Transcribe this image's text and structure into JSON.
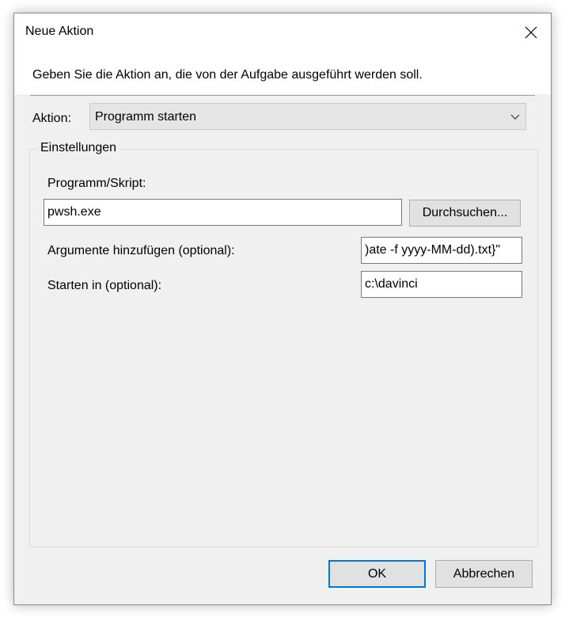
{
  "window": {
    "title": "Neue Aktion"
  },
  "header": {
    "instruction": "Geben Sie die Aktion an, die von der Aufgabe ausgeführt werden soll."
  },
  "action": {
    "label": "Aktion:",
    "selected": "Programm starten"
  },
  "settings": {
    "group_label": "Einstellungen",
    "program_label": "Programm/Skript:",
    "program_value": "pwsh.exe",
    "browse_label": "Durchsuchen...",
    "arguments_label": "Argumente hinzufügen (optional):",
    "arguments_value": ")ate -f yyyy-MM-dd).txt}\"",
    "startin_label": "Starten in (optional):",
    "startin_value": "c:\\davinci"
  },
  "buttons": {
    "ok": "OK",
    "cancel": "Abbrechen"
  },
  "colors": {
    "dialog_bg": "#f0f0f0",
    "focus_border": "#0078d7"
  }
}
